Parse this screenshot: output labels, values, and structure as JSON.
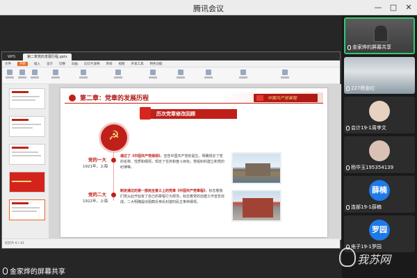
{
  "window": {
    "title": "腾讯会议",
    "controls": [
      "—",
      "□",
      "✕"
    ]
  },
  "share": {
    "label": "金家烨的屏幕共享"
  },
  "ppt": {
    "tabs": [
      "WPS",
      "第二章党的发展历程.pptx"
    ],
    "menu": [
      "文件",
      "开始",
      "插入",
      "设计",
      "切换",
      "动画",
      "幻灯片放映",
      "审阅",
      "视图",
      "开发工具",
      "特色功能"
    ],
    "status": "幻灯片 6 / 41"
  },
  "slide": {
    "chapter_title": "第二章：党章的发展历程",
    "banner": "中国共产党章程",
    "section": "历次党章修改回顾",
    "events": [
      {
        "name": "党的一大",
        "info": "1921年，上海",
        "lead": "通过了《中国共产党纲领》",
        "text": "，宣告中国共产党的诞生。明确规定了党的名称、性质和纲领，规定了任务和奋斗目标，党组织的建立和党的纪律等。"
      },
      {
        "name": "党的二大",
        "info": "1922年，上海",
        "lead": "制定通过的第一部完全意义上的党章《中国共产党章程》",
        "text": "，标志着我们党从此开始有了自己的章程行为规范，标志着党的创建工作宣告完成。二大明确提出阻截反帝反封建的民主革命纲领。"
      }
    ]
  },
  "participants": [
    {
      "name": "金家烨的屏幕共享",
      "type": "video"
    },
    {
      "name": "227杨金红",
      "type": "video"
    },
    {
      "name": "会计19-1周李文",
      "type": "face"
    },
    {
      "name": "杨华玉195354139",
      "type": "face"
    },
    {
      "name": "连部19-1薛楠",
      "type": "avatar",
      "initials": "薛楠"
    },
    {
      "name": "电子19-1罗园",
      "type": "avatar",
      "initials": "罗园"
    }
  ],
  "watermark": {
    "text": "我苏网"
  },
  "colors": {
    "party_red": "#c0201a",
    "active_border": "#2ecc71",
    "avatar_blue": "#1e7ae6"
  }
}
